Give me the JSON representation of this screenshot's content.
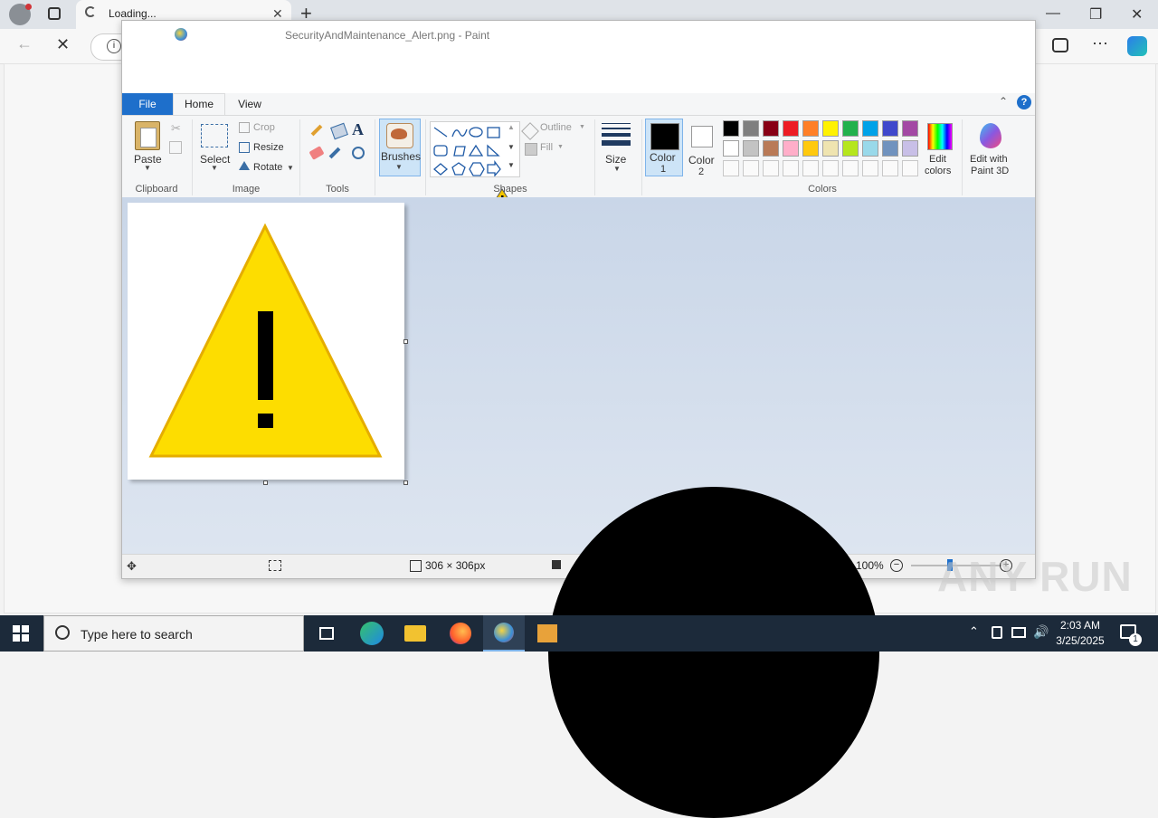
{
  "browser": {
    "tab_title": "Loading...",
    "new_tab": "+",
    "min": "—",
    "max": "❐",
    "close": "✕"
  },
  "paint": {
    "title": "SecurityAndMaintenance_Alert.png - Paint",
    "menu": {
      "file": "File",
      "home": "Home",
      "view": "View"
    },
    "clipboard": {
      "paste": "Paste",
      "group": "Clipboard"
    },
    "image": {
      "select": "Select",
      "crop": "Crop",
      "resize": "Resize",
      "rotate": "Rotate",
      "group": "Image"
    },
    "tools": {
      "group": "Tools",
      "text_glyph": "A"
    },
    "brushes": {
      "label": "Brushes"
    },
    "shapes": {
      "outline": "Outline",
      "fill": "Fill",
      "group": "Shapes"
    },
    "size": {
      "label": "Size"
    },
    "color1": {
      "label": "Color",
      "num": "1",
      "color": "#000000"
    },
    "color2": {
      "label": "Color",
      "num": "2",
      "color": "#ffffff"
    },
    "colors": {
      "group": "Colors",
      "row1": [
        "#000000",
        "#7f7f7f",
        "#880015",
        "#ed1c24",
        "#ff7f27",
        "#fff200",
        "#22b14c",
        "#00a2e8",
        "#3f48cc",
        "#a349a4"
      ],
      "row2": [
        "#ffffff",
        "#c3c3c3",
        "#b97a57",
        "#ffaec9",
        "#ffc90e",
        "#efe4b0",
        "#b5e61d",
        "#99d9ea",
        "#7092be",
        "#c8bfe7"
      ]
    },
    "edit_colors": {
      "line1": "Edit",
      "line2": "colors"
    },
    "edit_paint3d": {
      "line1": "Edit with",
      "line2": "Paint 3D"
    },
    "help": "?",
    "status": {
      "dimensions": "306 × 306px",
      "zoom": "100%"
    }
  },
  "taskbar": {
    "search_placeholder": "Type here to search",
    "time": "2:03 AM",
    "date": "3/25/2025",
    "notification_count": "1"
  },
  "watermark": "ANY RUN"
}
